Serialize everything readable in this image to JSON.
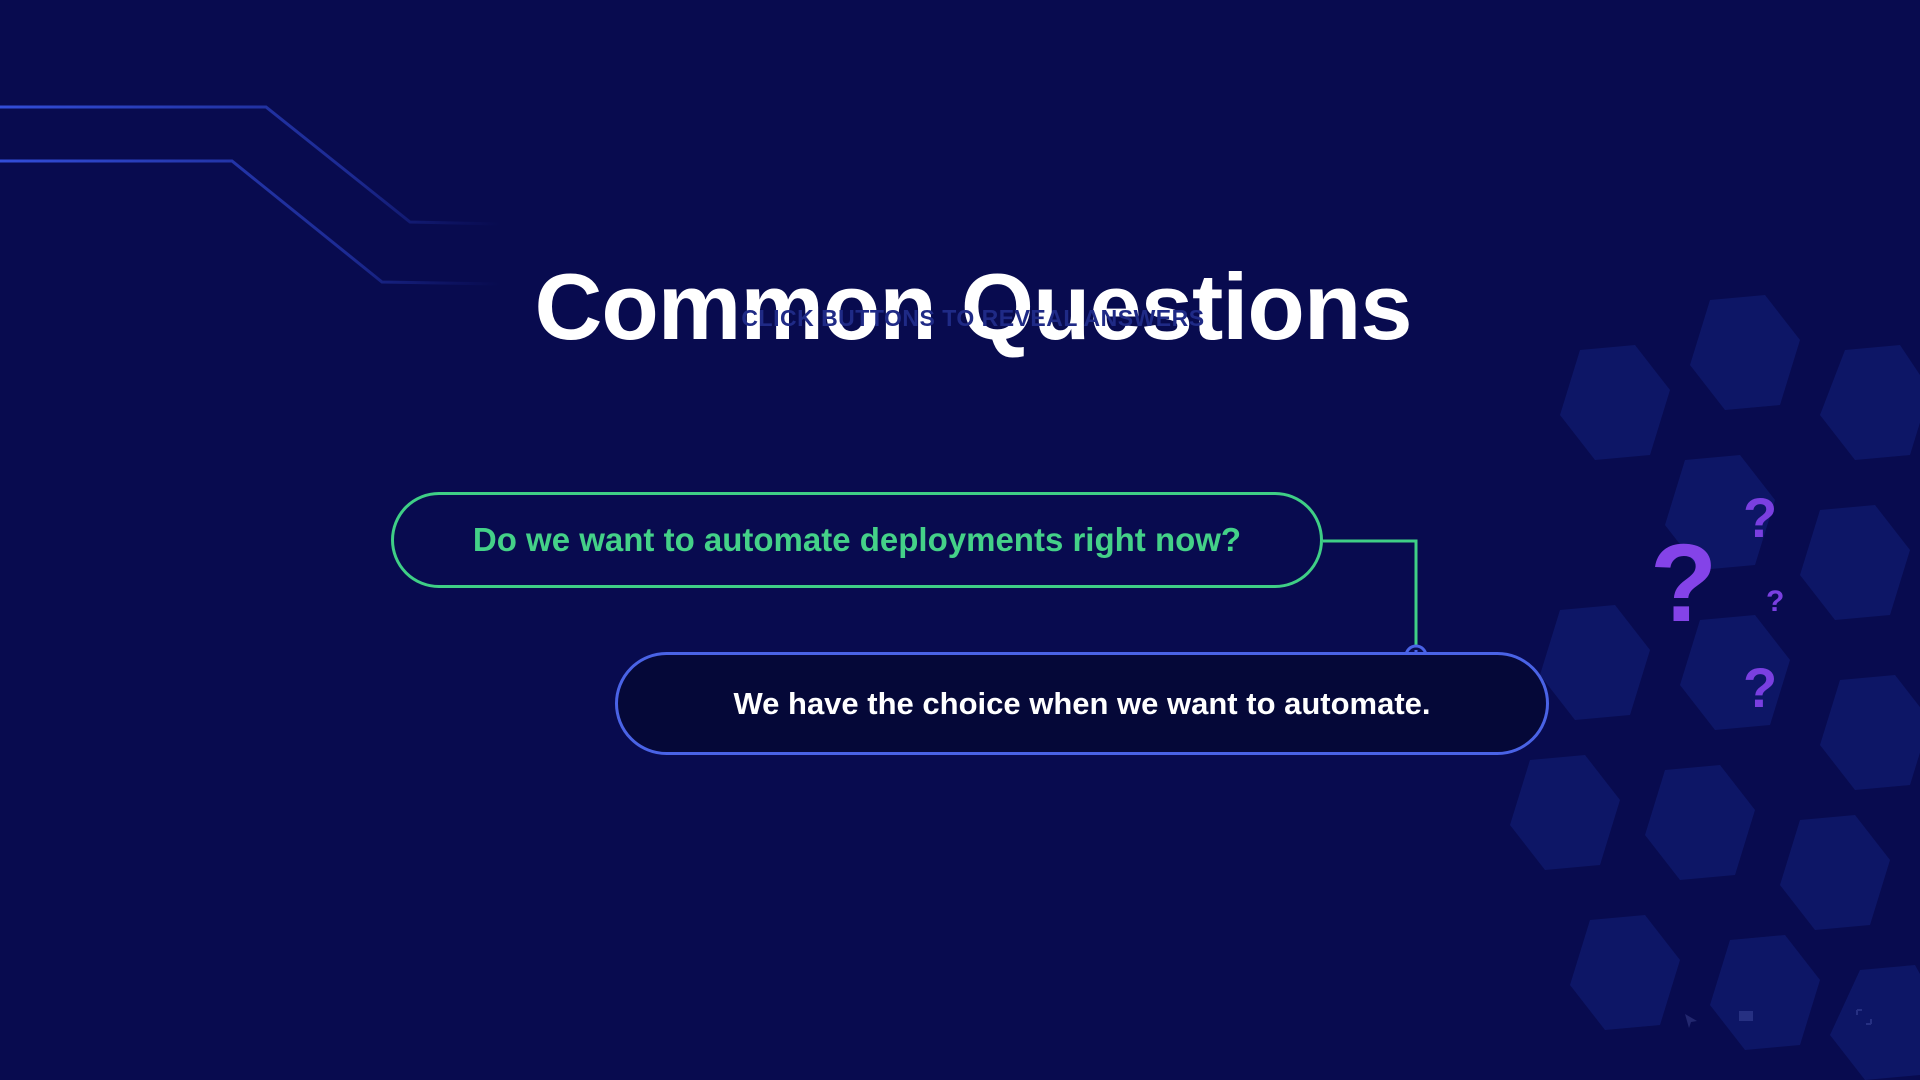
{
  "slide": {
    "title": "Common Questions",
    "subtitle": "CLICK BUTTONS TO REVEAL ANSWERS"
  },
  "qa": {
    "question": "Do we want to automate deployments right now?",
    "answer": "We have the choice when we want to automate."
  },
  "decor": {
    "question_mark": "?",
    "icons": [
      "question-mark-icon",
      "plus-circle-icon",
      "circuit-lines",
      "hexagon-pattern"
    ]
  },
  "colors": {
    "background": "#080b4f",
    "question_accent": "#3fcf86",
    "answer_accent": "#4a63e6",
    "question_marks": "#8443e8"
  }
}
